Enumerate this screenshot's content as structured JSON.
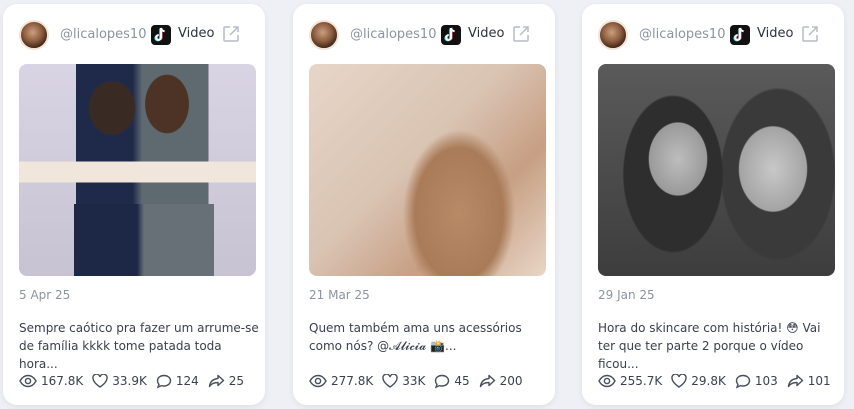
{
  "cards": [
    {
      "username": "@licalopes10",
      "platform_label": "Video",
      "date": "5 Apr 25",
      "caption_line1": "Sempre caótico pra fazer um arrume-se",
      "caption_line2": "de família kkkk tome patada toda hora...",
      "views": "167.8K",
      "likes": "33.9K",
      "comments": "124",
      "shares": "25"
    },
    {
      "username": "@licalopes10",
      "platform_label": "Video",
      "date": "21 Mar 25",
      "caption_line1": "Quem também ama uns acessórios",
      "caption_line2": "como nós? @𝓐𝓵𝓲𝓬𝓲𝓪 📸...",
      "views": "277.8K",
      "likes": "33K",
      "comments": "45",
      "shares": "200"
    },
    {
      "username": "@licalopes10",
      "platform_label": "Video",
      "date": "29 Jan 25",
      "caption_line1": "Hora do skincare com história! 😳 Vai",
      "caption_line2": "ter que ter parte 2 porque o vídeo ficou...",
      "views": "255.7K",
      "likes": "29.8K",
      "comments": "103",
      "shares": "101"
    }
  ],
  "icons": {
    "platform": "tiktok-icon",
    "link": "external-link-icon",
    "views": "eye-icon",
    "likes": "heart-icon",
    "comments": "comment-icon",
    "shares": "share-icon"
  }
}
